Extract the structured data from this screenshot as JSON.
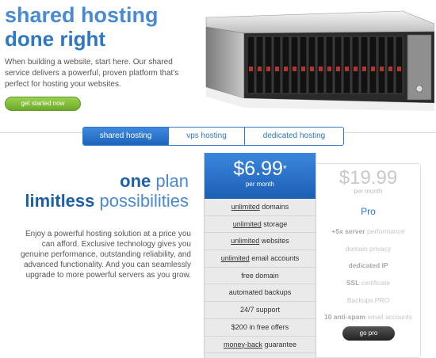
{
  "hero": {
    "title_line1": "shared hosting",
    "title_line2": "done right",
    "description": "When building a website, start here. Our shared service delivers a powerful, proven platform that's perfect for hosting your websites.",
    "cta_label": "get started now"
  },
  "tabs": [
    {
      "label": "shared hosting",
      "active": true
    },
    {
      "label": "vps hosting",
      "active": false
    },
    {
      "label": "dedicated hosting",
      "active": false
    }
  ],
  "pitch": {
    "line1_strong": "one",
    "line1_rest": " plan",
    "line2_strong": "limitless",
    "line2_rest": " possibilities",
    "body": "Enjoy a powerful hosting solution at a price you can afford. Exclusive technology gives you genuine performance, outstanding reliability, and advanced functionality. And you can seamlessly upgrade to more powerful servers as you grow."
  },
  "plan": {
    "price": "$6.99",
    "price_mark": "*",
    "period": "per month",
    "features": [
      {
        "strong": "unlimited",
        "rest": " domains"
      },
      {
        "strong": "unlimited",
        "rest": " storage"
      },
      {
        "strong": "unlimited",
        "rest": " websites"
      },
      {
        "strong": "unlimited",
        "rest": " email accounts"
      },
      {
        "strong": "",
        "rest": "free domain"
      },
      {
        "strong": "",
        "rest": "automated backups"
      },
      {
        "strong": "",
        "rest": "24/7 support"
      },
      {
        "strong": "",
        "rest": "$200 in free offers"
      },
      {
        "strong": "money-back",
        "rest": " guarantee"
      }
    ]
  },
  "pro": {
    "price": "$19.99",
    "period": "per month",
    "name": "Pro",
    "features": [
      {
        "strong": "+5x server",
        "rest": " performance"
      },
      {
        "strong": "",
        "rest": "domain privacy"
      },
      {
        "strong": "dedicated IP",
        "rest": ""
      },
      {
        "strong": "SSL",
        "rest": " certificate"
      },
      {
        "strong": "",
        "rest": "Backups PRO"
      },
      {
        "strong": "10 anti-spam",
        "rest": " email accounts"
      }
    ],
    "cta_label": "go pro"
  }
}
